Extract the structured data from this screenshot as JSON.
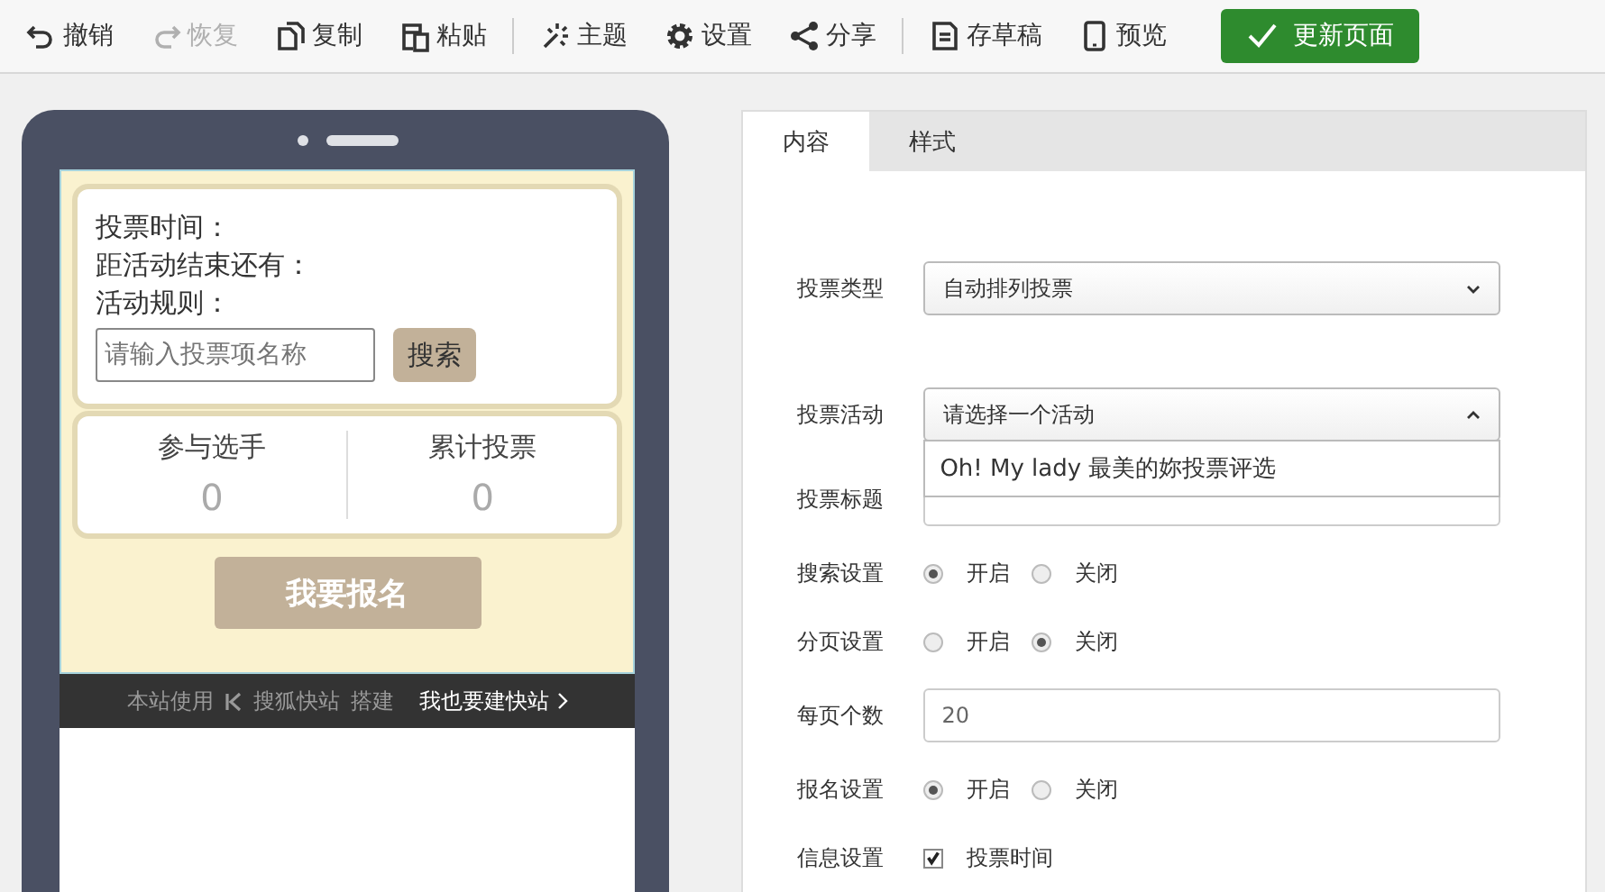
{
  "toolbar": {
    "groups": [
      [
        {
          "label": "撤销",
          "disabled": false
        },
        {
          "label": "恢复",
          "disabled": true
        },
        {
          "label": "复制",
          "disabled": false
        },
        {
          "label": "粘贴",
          "disabled": false
        }
      ],
      [
        {
          "label": "主题",
          "disabled": false
        },
        {
          "label": "设置",
          "disabled": false
        },
        {
          "label": "分享",
          "disabled": false
        }
      ],
      [
        {
          "label": "存草稿",
          "disabled": false
        },
        {
          "label": "预览",
          "disabled": false
        }
      ]
    ],
    "primary": "更新页面"
  },
  "preview": {
    "info_lines": [
      "投票时间：",
      "距活动结束还有：",
      "活动规则："
    ],
    "search": {
      "placeholder": "请输入投票项名称",
      "button": "搜索"
    },
    "stats": [
      {
        "label": "参与选手",
        "value": "0"
      },
      {
        "label": "累计投票",
        "value": "0"
      }
    ],
    "signup_button": "我要报名",
    "footer": {
      "prefix": "本站使用",
      "brand": "搜狐快站",
      "suffix": "搭建",
      "link": "我也要建快站"
    }
  },
  "settings": {
    "tabs": [
      {
        "label": "内容",
        "selected": true
      },
      {
        "label": "样式",
        "selected": false
      }
    ],
    "rows": [
      {
        "kind": "select",
        "label": "投票类型",
        "value": "自动排列投票",
        "expanded": false
      },
      {
        "kind": "select",
        "label": "投票活动",
        "value": "请选择一个活动",
        "expanded": true,
        "options": [
          "Oh! My lady 最美的妳投票评选"
        ]
      },
      {
        "kind": "input",
        "label": "投票标题"
      },
      {
        "kind": "radio",
        "label": "搜索设置",
        "options": [
          {
            "label": "开启",
            "selected": true
          },
          {
            "label": "关闭",
            "selected": false
          }
        ]
      },
      {
        "kind": "radio",
        "label": "分页设置",
        "options": [
          {
            "label": "开启",
            "selected": false
          },
          {
            "label": "关闭",
            "selected": true
          }
        ]
      },
      {
        "kind": "input",
        "label": "每页个数",
        "value": "20"
      },
      {
        "kind": "radio",
        "label": "报名设置",
        "options": [
          {
            "label": "开启",
            "selected": true
          },
          {
            "label": "关闭",
            "selected": false
          }
        ]
      },
      {
        "kind": "checkbox",
        "label": "信息设置",
        "options": [
          {
            "label": "投票时间",
            "checked": true
          }
        ]
      }
    ]
  }
}
